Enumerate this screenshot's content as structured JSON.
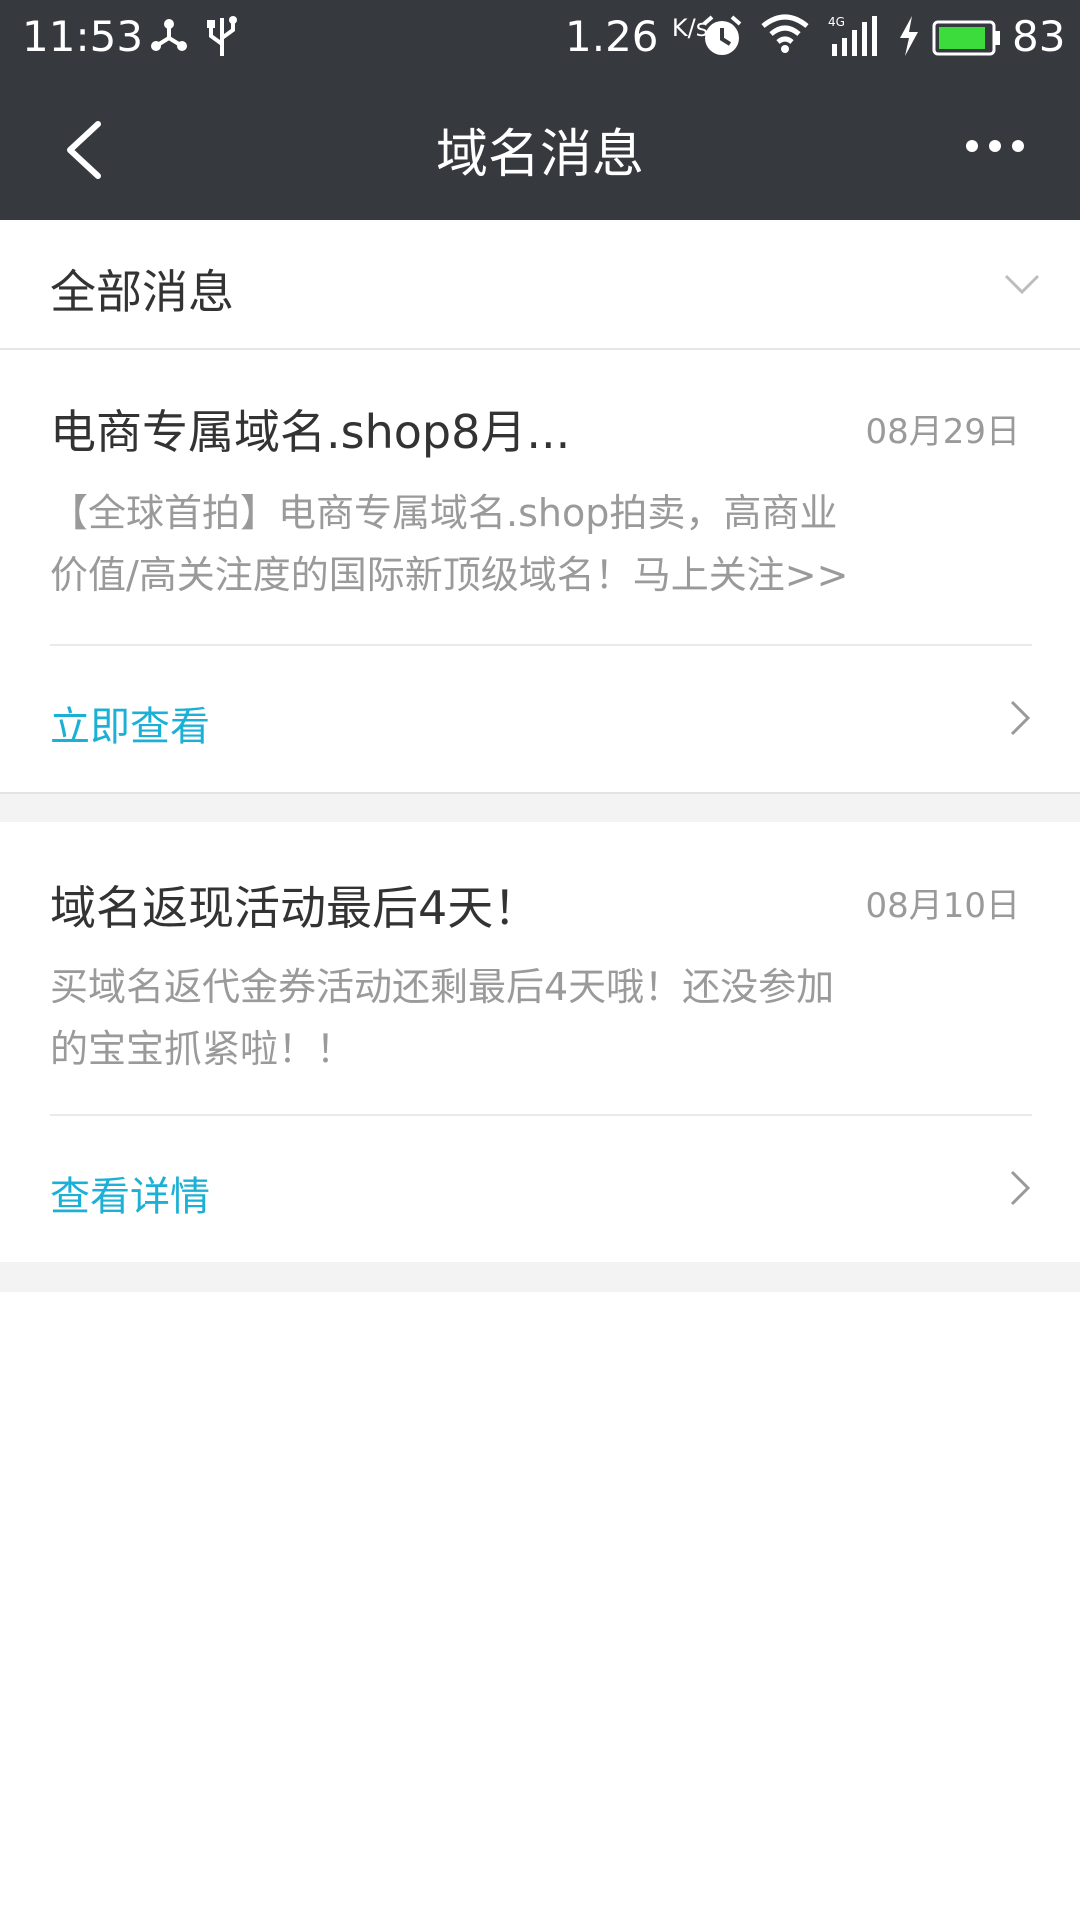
{
  "status_bar": {
    "time": "11:53",
    "network_speed": "1.26",
    "network_speed_unit": "K/s",
    "battery": "83",
    "icons": [
      "usb-share-icon",
      "usb-icon",
      "alarm-icon",
      "wifi-icon",
      "4g-signal-icon",
      "charging-icon",
      "battery-icon"
    ]
  },
  "header": {
    "title": "域名消息",
    "back_icon": "chevron-left-icon",
    "more_icon": "more-dots-icon"
  },
  "filter": {
    "label": "全部消息",
    "icon": "chevron-down-icon"
  },
  "messages": [
    {
      "title": "电商专属域名.shop8月...",
      "date": "08月29日",
      "body_line1": "【全球首拍】电商专属域名.shop拍卖，高商业",
      "body_line2": "价值/高关注度的国际新顶级域名！马上关注>>",
      "action": "立即查看"
    },
    {
      "title": "域名返现活动最后4天！",
      "date": "08月10日",
      "body_line1": "买域名返代金券活动还剩最后4天哦！还没参加",
      "body_line2": "的宝宝抓紧啦！！",
      "action": "查看详情"
    }
  ],
  "colors": {
    "header_bg": "#363a3f",
    "accent": "#1cb0d6",
    "muted_text": "#9a9a9a",
    "separator_bg": "#f3f3f3"
  }
}
